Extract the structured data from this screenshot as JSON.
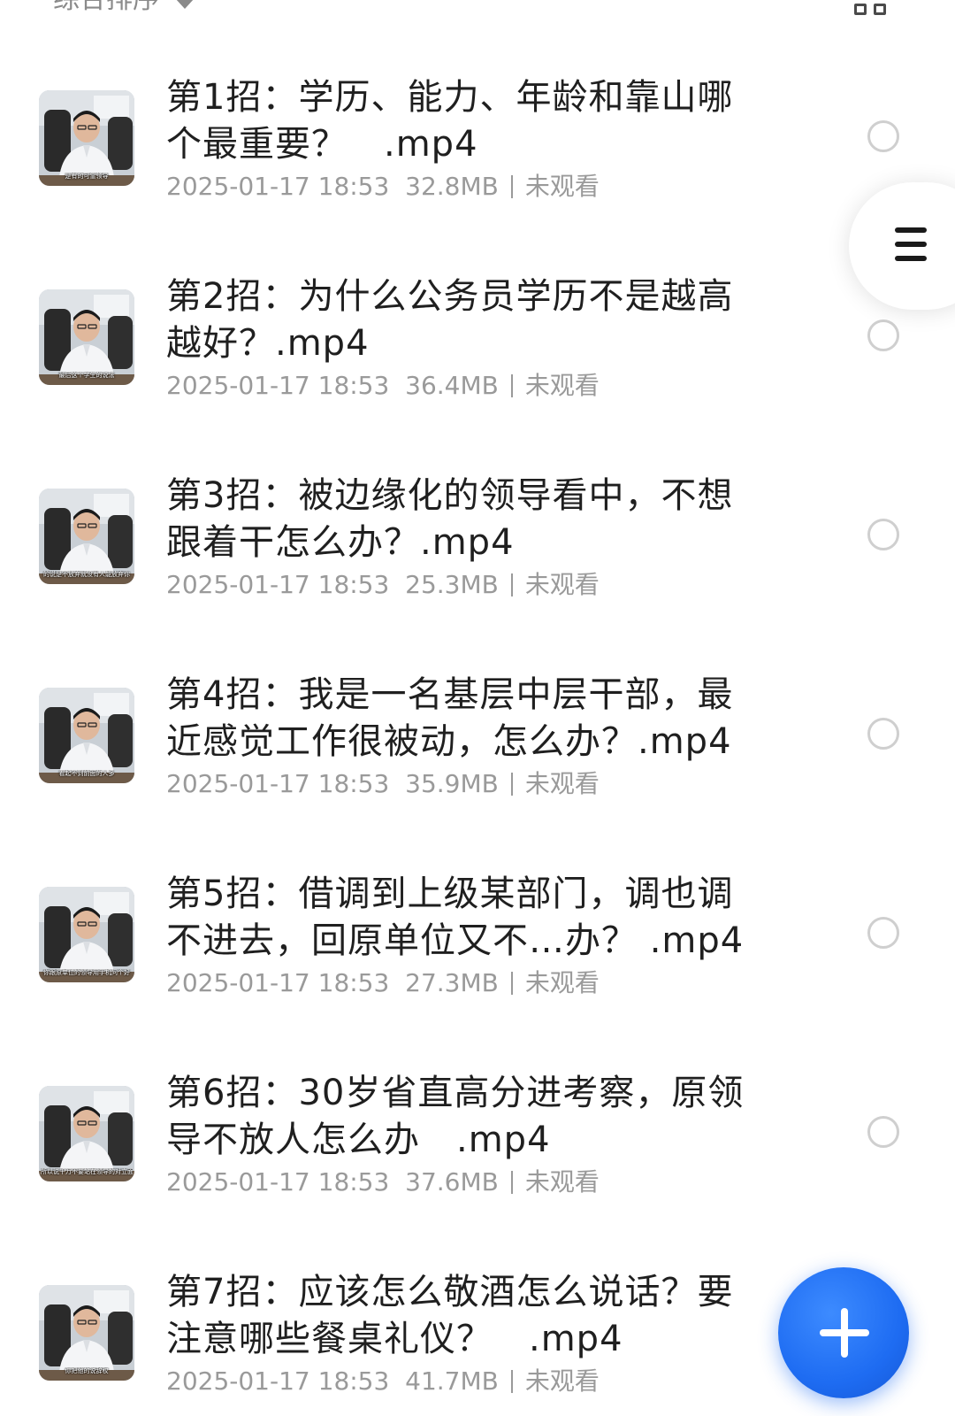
{
  "toolbar": {
    "sort_label": "综合排序",
    "sort_icon": "caret-down-icon",
    "view_toggle_icon": "grid-view-icon"
  },
  "side_menu": {
    "icon": "menu-icon"
  },
  "fab": {
    "icon": "plus-icon",
    "color": "#1e6cf2"
  },
  "files": [
    {
      "title": "第1招：学历、能力、年龄和靠山哪个最重要？　.mp4",
      "date": "2025-01-17 18:53",
      "size": "32.8MB",
      "status": "未观看",
      "thumb_caption": "是有的可靠领导"
    },
    {
      "title": "第2招：为什么公务员学历不是越高越好？.mp4",
      "date": "2025-01-17 18:53",
      "size": "36.4MB",
      "status": "未观看",
      "thumb_caption": "最后这个学生的说法"
    },
    {
      "title": "第3招：被边缘化的领导看中，不想跟着干怎么办？.mp4",
      "date": "2025-01-17 18:53",
      "size": "25.3MB",
      "status": "未观看",
      "thumb_caption": "的说是不放弃就没有人能放弃你"
    },
    {
      "title": "第4招：我是一名基层中层干部，最近感觉工作很被动，怎么办？.mp4",
      "date": "2025-01-17 18:53",
      "size": "35.9MB",
      "status": "未观看",
      "thumb_caption": "看起不到前面的人多"
    },
    {
      "title": "第5招：借调到上级某部门，调也调不进去，回原单位又不…办？ .mp4",
      "date": "2025-01-17 18:53",
      "size": "27.3MB",
      "status": "未观看",
      "thumb_caption": "你跟原单位的领导用手机问个好"
    },
    {
      "title": "第6招：30岁省直高分进考察，原领导不放人怎么办　.mp4",
      "date": "2025-01-17 18:53",
      "size": "37.6MB",
      "status": "未观看",
      "thumb_caption": "所以说千万不要站在领导的对立面"
    },
    {
      "title": "第7招：应该怎么敬酒怎么说话？要注意哪些餐桌礼仪？　.mp4",
      "date": "2025-01-17 18:53",
      "size": "41.7MB",
      "status": "未观看",
      "thumb_caption": "你把他的说辞权"
    }
  ]
}
